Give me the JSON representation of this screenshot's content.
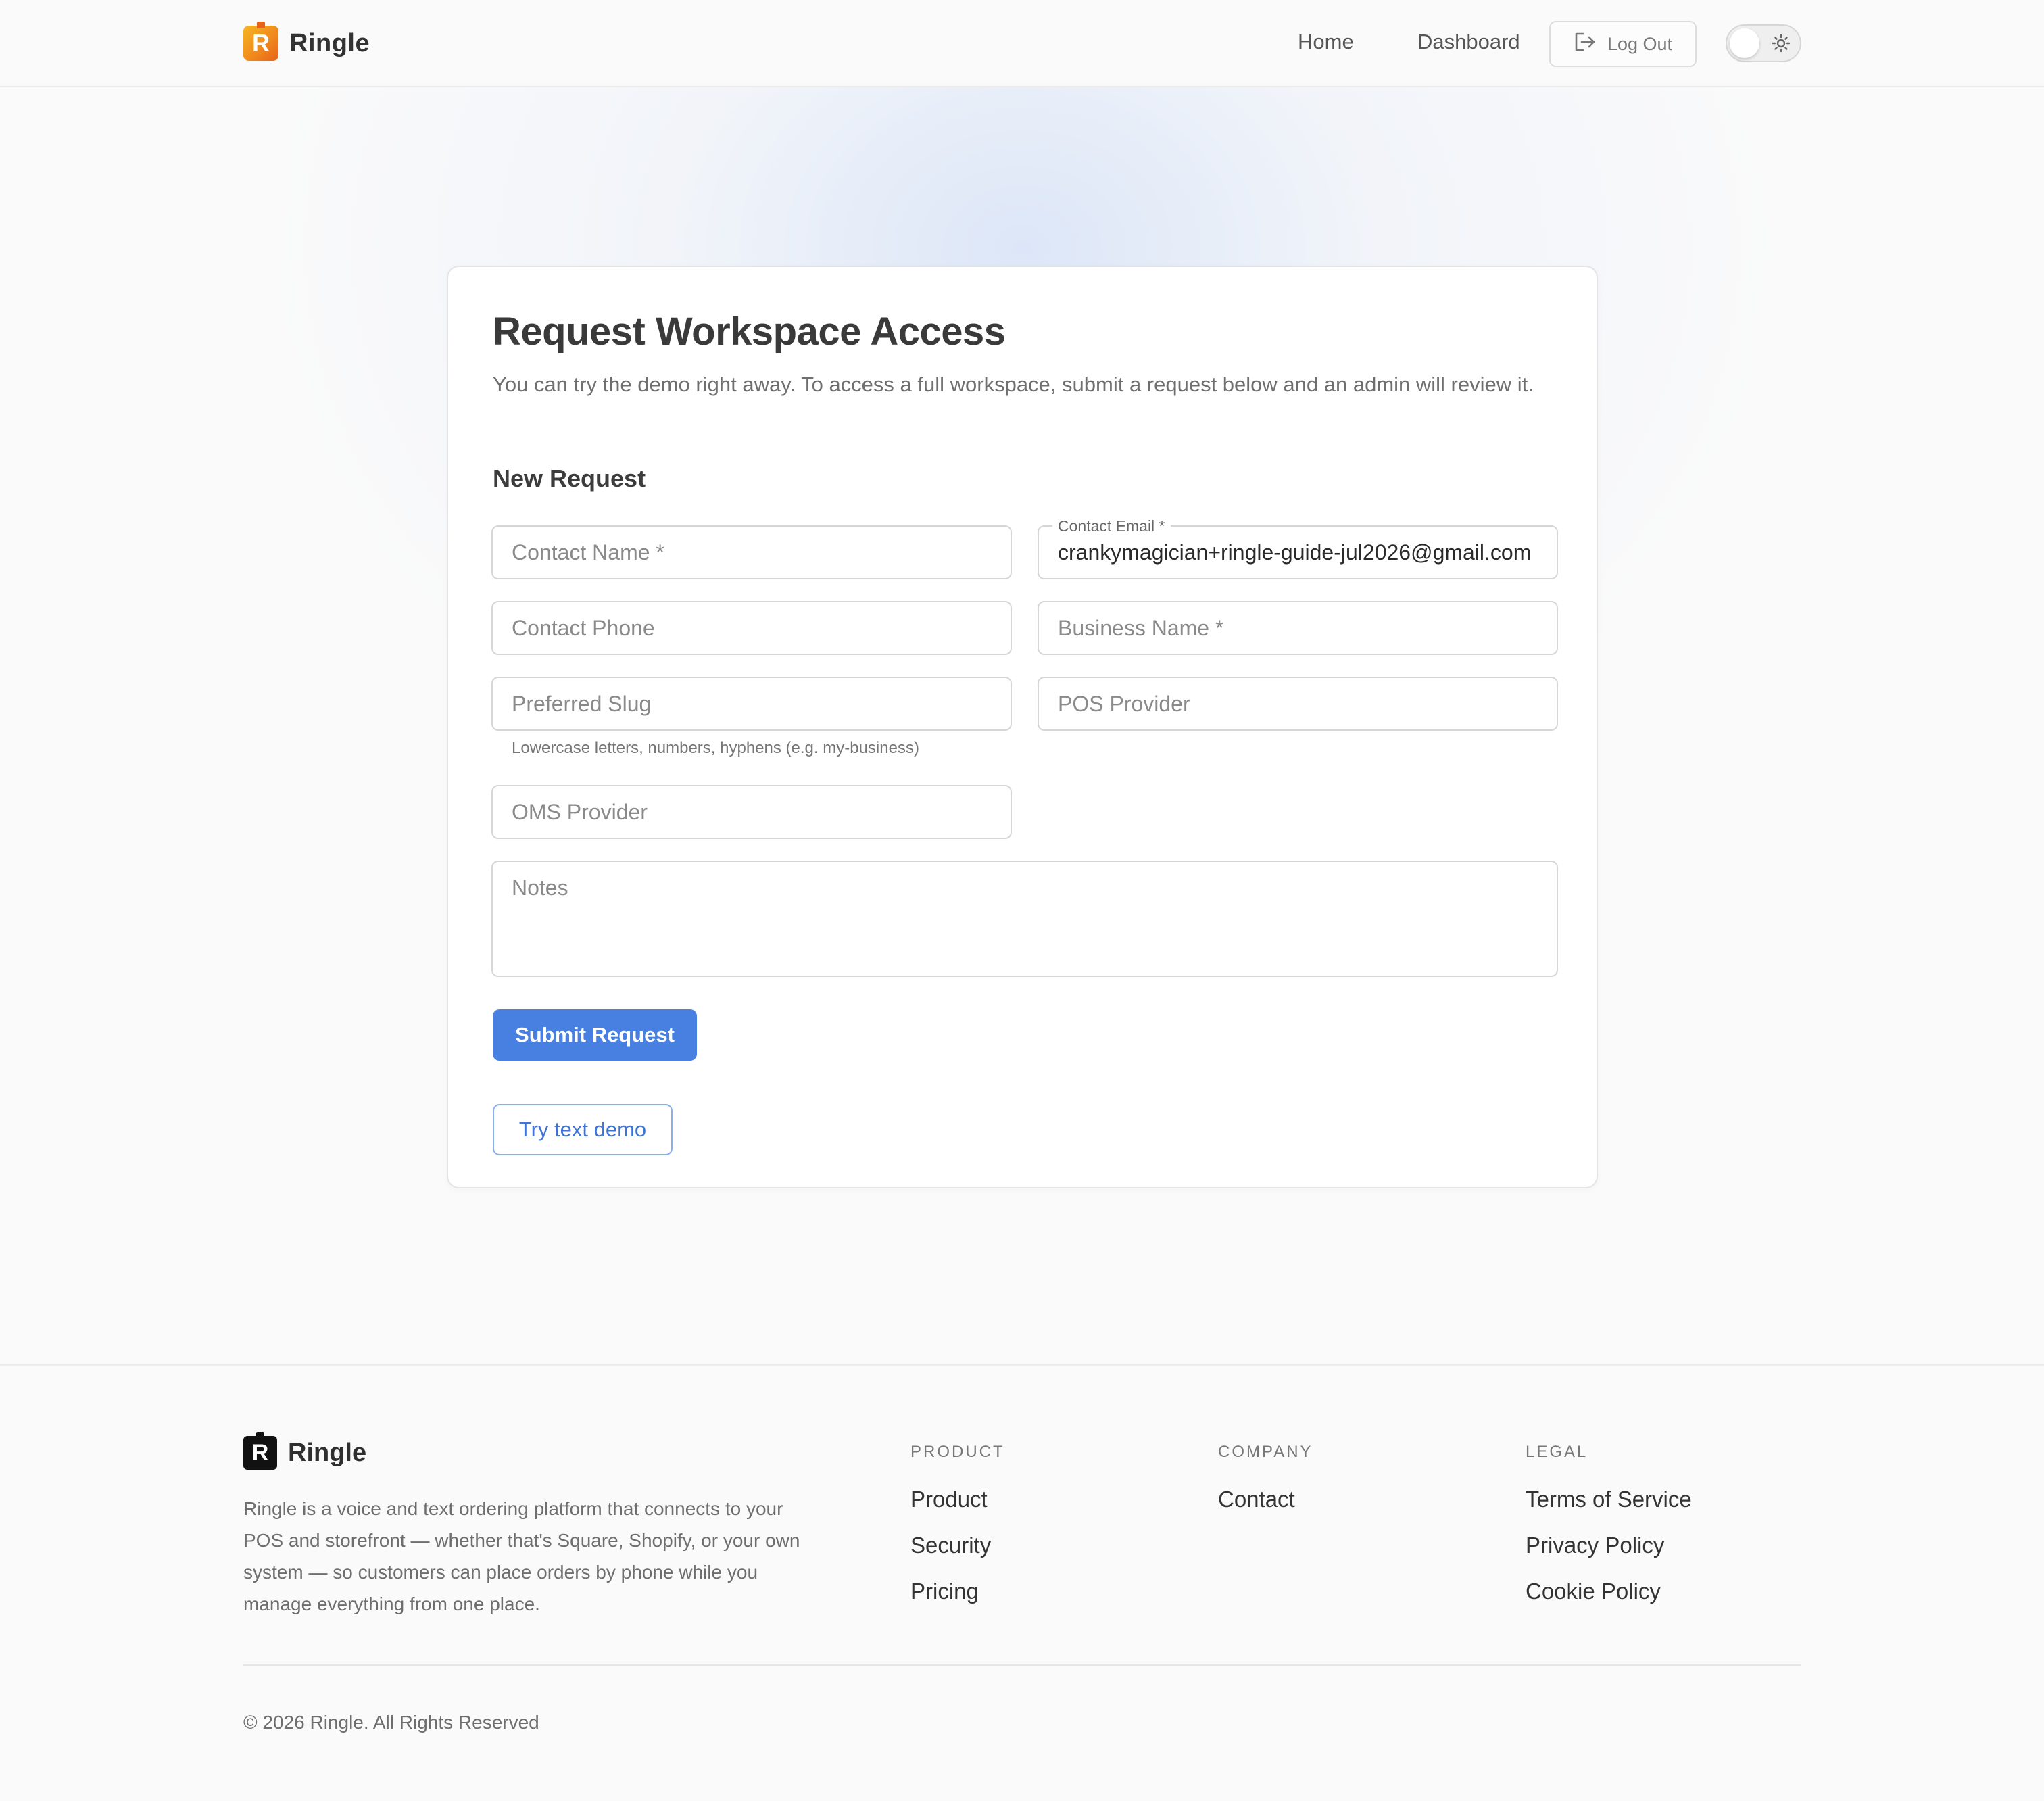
{
  "header": {
    "brand": "Ringle",
    "logo_letter": "R",
    "nav": {
      "home": "Home",
      "dashboard": "Dashboard",
      "logout": "Log Out"
    },
    "theme_toggle_icon": "sun-icon"
  },
  "form": {
    "title": "Request Workspace Access",
    "subtitle": "You can try the demo right away. To access a full workspace, submit a request below and an admin will review it.",
    "section_title": "New Request",
    "fields": {
      "contact_name": {
        "placeholder": "Contact Name *",
        "value": ""
      },
      "contact_email": {
        "label": "Contact Email *",
        "value": "crankymagician+ringle-guide-jul2026@gmail.com"
      },
      "contact_phone": {
        "placeholder": "Contact Phone",
        "value": ""
      },
      "business_name": {
        "placeholder": "Business Name *",
        "value": ""
      },
      "preferred_slug": {
        "placeholder": "Preferred Slug",
        "value": "",
        "helper": "Lowercase letters, numbers, hyphens (e.g. my-business)"
      },
      "pos_provider": {
        "placeholder": "POS Provider",
        "value": ""
      },
      "oms_provider": {
        "placeholder": "OMS Provider",
        "value": ""
      },
      "notes": {
        "placeholder": "Notes",
        "value": ""
      }
    },
    "submit_label": "Submit Request",
    "demo_label": "Try text demo"
  },
  "footer": {
    "brand": "Ringle",
    "logo_letter": "R",
    "description": "Ringle is a voice and text ordering platform that connects to your POS and storefront — whether that's Square, Shopify, or your own system — so customers can place orders by phone while you manage everything from one place.",
    "columns": [
      {
        "heading": "PRODUCT",
        "links": [
          "Product",
          "Security",
          "Pricing"
        ]
      },
      {
        "heading": "COMPANY",
        "links": [
          "Contact"
        ]
      },
      {
        "heading": "LEGAL",
        "links": [
          "Terms of Service",
          "Privacy Policy",
          "Cookie Policy"
        ]
      }
    ],
    "copyright": "© 2026 Ringle. All Rights Reserved"
  },
  "colors": {
    "primary": "#4780e0",
    "brand_orange": "#f08a1c"
  }
}
